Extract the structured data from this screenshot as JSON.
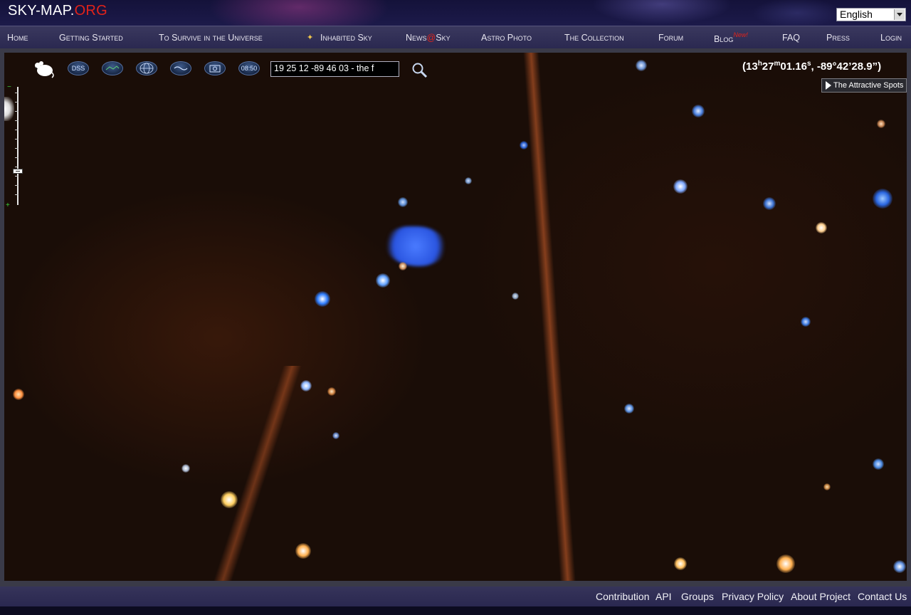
{
  "header": {
    "logo_main": "SKY-MAP.",
    "logo_accent": "ORG",
    "language": "English"
  },
  "nav": [
    {
      "label": "Home"
    },
    {
      "label": "Getting Started"
    },
    {
      "label": "To Survive in the Universe"
    },
    {
      "label": "Inhabited Sky"
    },
    {
      "label_pre": "News",
      "label_at": "@",
      "label_post": "Sky"
    },
    {
      "label": "Astro Photo"
    },
    {
      "label": "The Collection"
    },
    {
      "label": "Forum"
    },
    {
      "label": "Blog",
      "badge": "New!"
    },
    {
      "label": "FAQ"
    },
    {
      "label": "Press"
    },
    {
      "label": "Login"
    }
  ],
  "toolbar": {
    "dss_label": "DSS",
    "clock_label": "08:50",
    "search_value": "19 25 12 -89 46 03 - the f",
    "icons": [
      "mouse-icon",
      "dss-icon",
      "constellation-icon",
      "grid-icon",
      "milky-way-icon",
      "camera-icon",
      "clock-icon",
      "search-icon"
    ]
  },
  "coords": {
    "ra_h": "13",
    "ra_h_unit": "h",
    "ra_m": "27",
    "ra_m_unit": "m",
    "ra_s": "01.16",
    "ra_s_unit": "s",
    "dec": "-89°42’28.9”"
  },
  "attractive_spots": "The Attractive Spots",
  "footer": [
    {
      "label": "Contribution"
    },
    {
      "label": "API"
    },
    {
      "label": "Groups"
    },
    {
      "label": "Privacy Policy"
    },
    {
      "label": "About Project"
    },
    {
      "label": "Contact Us"
    }
  ],
  "colors": {
    "accent_red": "#e2231a",
    "nav_bg": "#2a2850",
    "sky_bg": "#1a0d07"
  }
}
